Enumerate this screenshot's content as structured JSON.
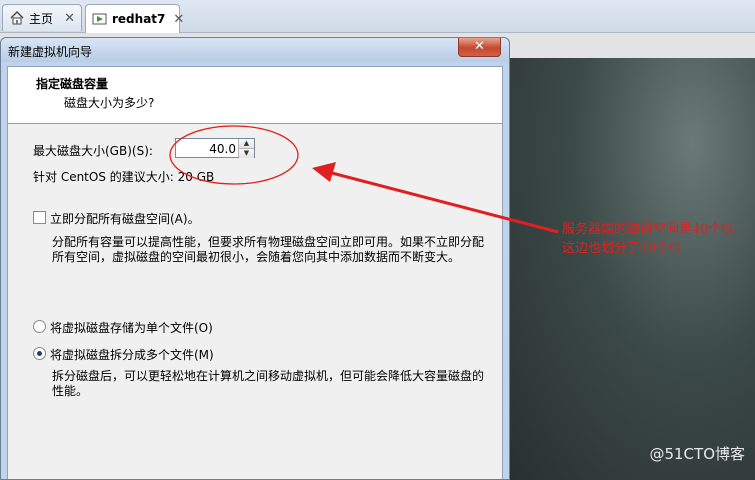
{
  "tabs": [
    {
      "label": "主页"
    },
    {
      "label": "redhat7"
    }
  ],
  "dialog": {
    "title": "新建虚拟机向导",
    "close": "✕",
    "header_title": "指定磁盘容量",
    "header_subtitle": "磁盘大小为多少?",
    "max_size_label": "最大磁盘大小(GB)(S):",
    "max_size_value": "40.0",
    "recommend_text": "针对 CentOS 的建议大小: 20 GB",
    "allocate_label": "立即分配所有磁盘空间(A)。",
    "allocate_checked": false,
    "allocate_desc": "分配所有容量可以提高性能，但要求所有物理磁盘空间立即可用。如果不立即分配所有空间，虚拟磁盘的空间最初很小，会随着您向其中添加数据而不断变大。",
    "single_file_label": "将虚拟磁盘存储为单个文件(O)",
    "multi_file_label": "将虚拟磁盘拆分成多个文件(M)",
    "selected_option": "multi",
    "multi_desc": "拆分磁盘后，可以更轻松地在计算机之间移动虚拟机，但可能会降低大容量磁盘的性能。"
  },
  "annotation": {
    "text": "服务器端的磁盘空间是40个G，这边也划分了40个G",
    "color": "#e02020"
  },
  "watermark": "@51CTO博客"
}
